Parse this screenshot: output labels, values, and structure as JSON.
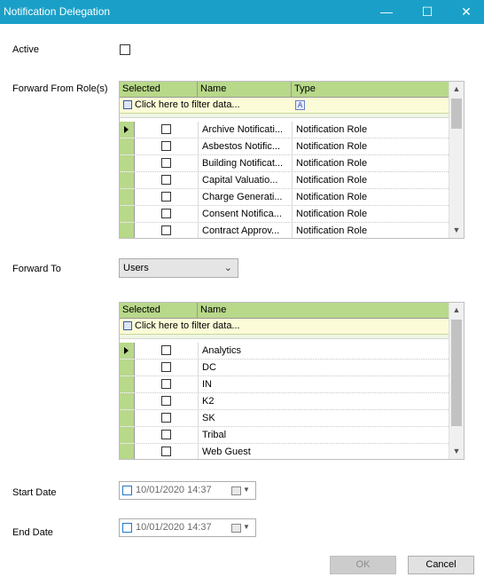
{
  "window": {
    "title": "Notification Delegation",
    "minimize_glyph": "—",
    "maximize_glyph": "☐",
    "close_glyph": "✕",
    "accent_color": "#1aa0c8"
  },
  "form": {
    "active_label": "Active",
    "active_checked": false,
    "forward_from_label": "Forward From Role(s)",
    "forward_to_label": "Forward To",
    "forward_to_value": "Users",
    "start_date_label": "Start Date",
    "start_date_value": "10/01/2020 14:37",
    "end_date_label": "End Date",
    "end_date_value": "10/01/2020 14:37"
  },
  "roles_grid": {
    "columns": [
      "Selected",
      "Name",
      "Type"
    ],
    "filter_text": "Click here to filter data...",
    "filter_type_icon": "A",
    "rows": [
      {
        "name": "Archive Notificati...",
        "type": "Notification Role"
      },
      {
        "name": "Asbestos Notific...",
        "type": "Notification Role"
      },
      {
        "name": "Building Notificat...",
        "type": "Notification Role"
      },
      {
        "name": "Capital Valuatio...",
        "type": "Notification Role"
      },
      {
        "name": "Charge Generati...",
        "type": "Notification Role"
      },
      {
        "name": "Consent Notifica...",
        "type": "Notification Role"
      },
      {
        "name": "Contract Approv...",
        "type": "Notification Role"
      }
    ]
  },
  "users_grid": {
    "columns": [
      "Selected",
      "Name"
    ],
    "filter_text": "Click here to filter data...",
    "rows": [
      {
        "name": "Analytics"
      },
      {
        "name": "DC"
      },
      {
        "name": "IN"
      },
      {
        "name": "K2"
      },
      {
        "name": "SK"
      },
      {
        "name": "Tribal"
      },
      {
        "name": "Web Guest"
      }
    ]
  },
  "buttons": {
    "ok_label": "OK",
    "cancel_label": "Cancel"
  },
  "icons": {
    "scroll_up": "▲",
    "scroll_down": "▼",
    "dropdown": "⌄"
  }
}
